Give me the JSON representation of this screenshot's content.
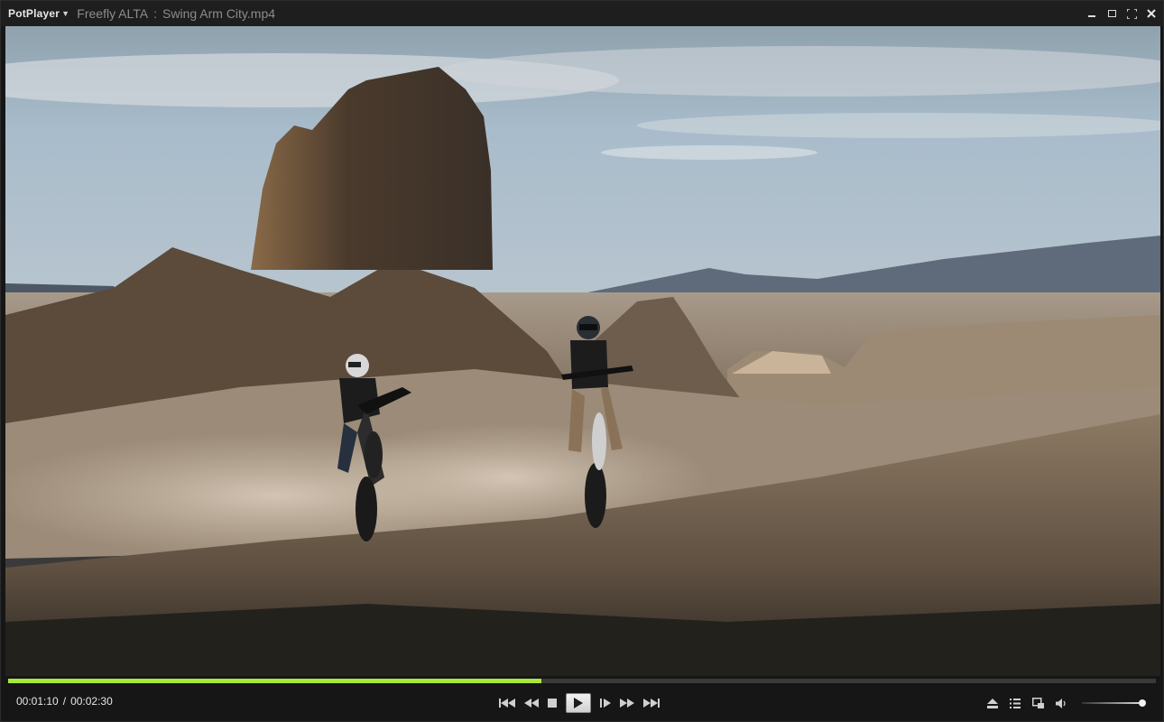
{
  "app": {
    "name": "PotPlayer",
    "window_title_prefix": "Freefly ALTA",
    "window_title_separator": ":",
    "file_name": "Swing Arm City.mp4"
  },
  "window_controls": [
    "minimize-icon",
    "maximize-icon",
    "fullscreen-icon",
    "close-icon"
  ],
  "playback": {
    "current_time": "00:01:10",
    "time_separator": "/",
    "total_time": "00:02:30",
    "progress_fraction": 0.465,
    "volume_fraction": 0.95
  },
  "center_buttons": [
    "previous-icon",
    "rewind-icon",
    "stop-icon",
    "play-icon",
    "frame-step-icon",
    "fast-forward-icon",
    "next-icon"
  ],
  "right_buttons": [
    "eject-icon",
    "playlist-icon",
    "pip-icon",
    "volume-icon"
  ],
  "colors": {
    "progress": "#a8e83a",
    "background": "#161616",
    "titlebar": "#1e1e1e"
  }
}
